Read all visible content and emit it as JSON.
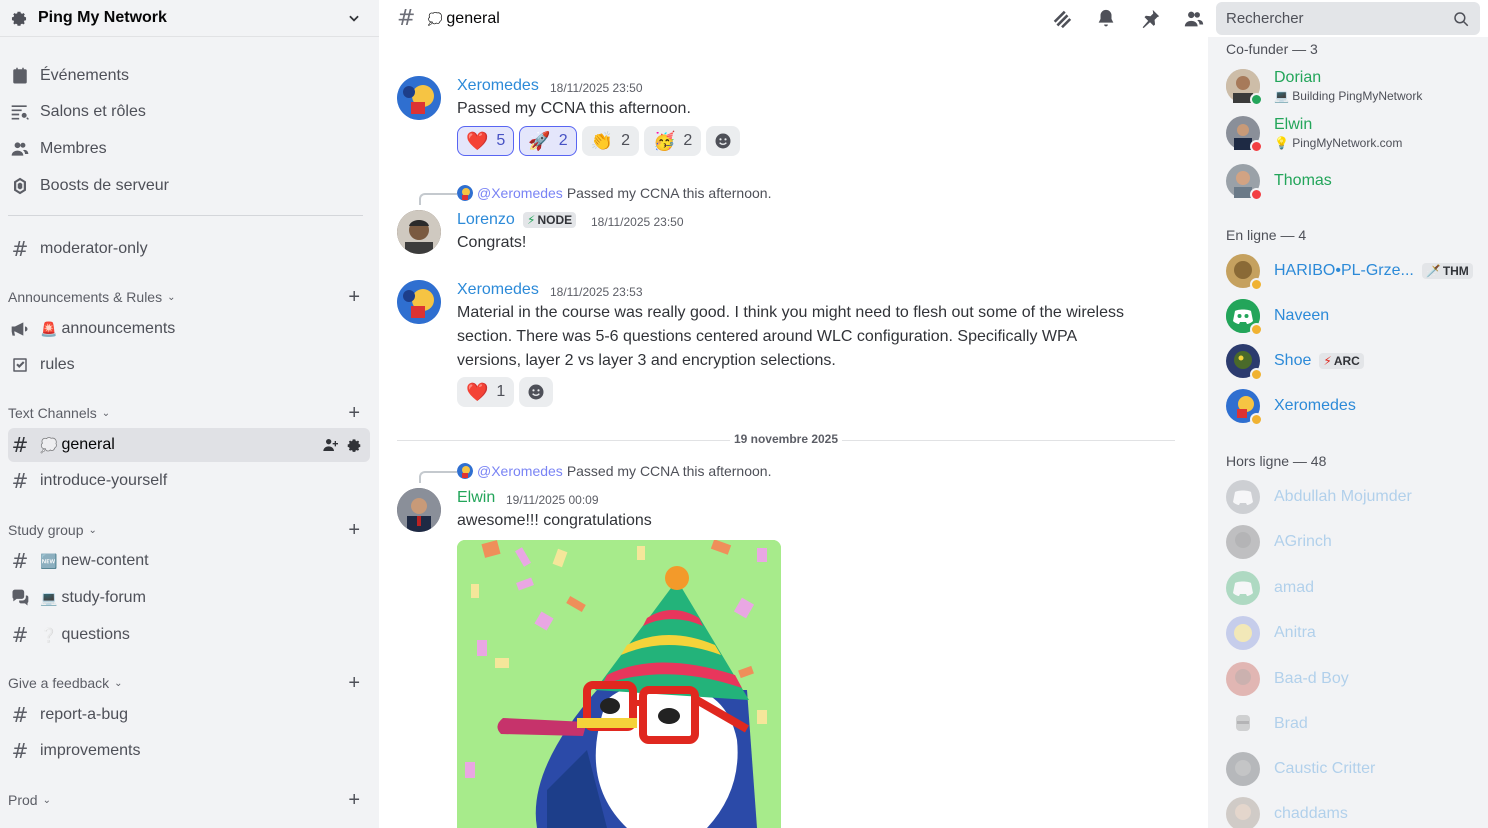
{
  "server": {
    "name": "Ping My Network"
  },
  "sidebar": {
    "top_items": [
      {
        "label": "Événements",
        "icon": "calendar-icon"
      },
      {
        "label": "Salons et rôles",
        "icon": "channels-roles-icon"
      },
      {
        "label": "Membres",
        "icon": "members-icon"
      },
      {
        "label": "Boosts de serveur",
        "icon": "boost-icon"
      }
    ],
    "moderator": {
      "label": "moderator-only",
      "icon": "locked-hash-icon"
    },
    "categories": [
      {
        "label": "Announcements & Rules",
        "channels": [
          {
            "label": "announcements",
            "emoji": "🚨",
            "icon": "megaphone-icon"
          },
          {
            "label": "rules",
            "icon": "rules-checkbox-icon"
          }
        ]
      },
      {
        "label": "Text Channels",
        "channels": [
          {
            "label": "general",
            "emoji": "💭",
            "icon": "hash-icon",
            "active": true
          },
          {
            "label": "introduce-yourself",
            "icon": "hash-icon"
          }
        ]
      },
      {
        "label": "Study group",
        "channels": [
          {
            "label": "new-content",
            "emoji": "🆕",
            "icon": "hash-icon"
          },
          {
            "label": "study-forum",
            "emoji": "💻",
            "icon": "forum-icon"
          },
          {
            "label": "questions",
            "emoji": "❔",
            "icon": "hash-icon"
          }
        ]
      },
      {
        "label": "Give a feedback",
        "channels": [
          {
            "label": "report-a-bug",
            "icon": "hash-icon"
          },
          {
            "label": "improvements",
            "icon": "hash-icon"
          }
        ]
      },
      {
        "label": "Prod",
        "channels": []
      }
    ]
  },
  "topbar": {
    "channel_name": "general",
    "channel_emoji": "💭",
    "search_placeholder": "Rechercher"
  },
  "messages": [
    {
      "author": "Xeromedes",
      "author_color": "#2c8ad8",
      "time": "18/11/2025 23:50",
      "text": "Passed my CCNA this afternoon.",
      "reactions": [
        {
          "emoji": "❤️",
          "count": "5",
          "me": true
        },
        {
          "emoji": "🚀",
          "count": "2",
          "me": true
        },
        {
          "emoji": "👏",
          "count": "2",
          "me": false
        },
        {
          "emoji": "🥳",
          "count": "2",
          "me": false
        }
      ]
    },
    {
      "reply_to": "@Xeromedes",
      "reply_text": "Passed my CCNA this afternoon.",
      "author": "Lorenzo",
      "author_color": "#2c8ad8",
      "tag": "NODE",
      "tag_emoji": "⚡",
      "time": "18/11/2025 23:50",
      "text": "Congrats!"
    },
    {
      "author": "Xeromedes",
      "author_color": "#2c8ad8",
      "time": "18/11/2025 23:53",
      "text_lines": [
        "Material in the course was really good. I think you might need to flesh out some of the wireless",
        "section. There was 5-6 questions centered around WLC configuration. Specifically WPA",
        "versions, layer 2 vs layer 3 and encryption selections."
      ],
      "reactions": [
        {
          "emoji": "❤️",
          "count": "1",
          "me": false
        }
      ]
    },
    {
      "reply_to": "@Xeromedes",
      "reply_text": "Passed my CCNA this afternoon.",
      "author": "Elwin",
      "author_color": "#23a55a",
      "time": "19/11/2025 00:09",
      "text": "awesome!!! congratulations"
    }
  ],
  "date_divider": "19 novembre 2025",
  "members": {
    "cofounder_header": "Co-funder — 3",
    "cofounders": [
      {
        "name": "Dorian",
        "status": "Building PingMyNetwork",
        "status_emoji": "💻",
        "presence": "online"
      },
      {
        "name": "Elwin",
        "status": "PingMyNetwork.com",
        "status_emoji": "💡",
        "presence": "dnd"
      },
      {
        "name": "Thomas",
        "status": "",
        "presence": "dnd"
      }
    ],
    "online_header": "En ligne — 4",
    "online": [
      {
        "name": "HARIBO•PL-Grze...",
        "tag": "THM",
        "tag_emoji": "🗡️"
      },
      {
        "name": "Naveen"
      },
      {
        "name": "Shoe",
        "tag": "ARC",
        "tag_emoji": "⚡"
      },
      {
        "name": "Xeromedes"
      }
    ],
    "offline_header": "Hors ligne — 48",
    "offline": [
      {
        "name": "Abdullah Mojumder"
      },
      {
        "name": "AGrinch"
      },
      {
        "name": "amad"
      },
      {
        "name": "Anitra"
      },
      {
        "name": "Baa-d Boy"
      },
      {
        "name": "Brad"
      },
      {
        "name": "Caustic Critter"
      },
      {
        "name": "chaddams"
      }
    ]
  },
  "colors": {
    "accent": "#5865f2",
    "cofounder": "#23a55a",
    "member": "#2c8ad8",
    "online": "#23a55a",
    "dnd": "#f23f43",
    "idle": "#f0b232"
  }
}
